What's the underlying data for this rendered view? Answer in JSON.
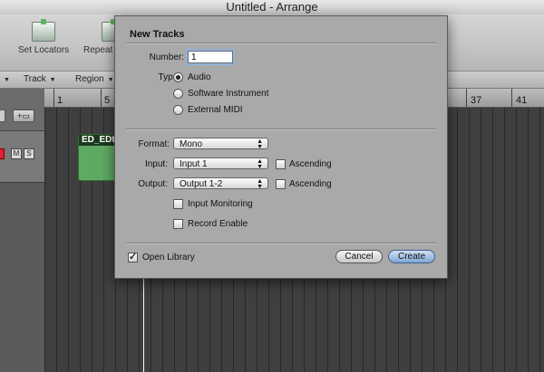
{
  "window": {
    "title": "Untitled - Arrange"
  },
  "toolbar": {
    "set_locators": "Set Locators",
    "repeat": "Repeat"
  },
  "local_menu": {
    "track": "Track",
    "region": "Region"
  },
  "ruler": {
    "bars": [
      "1",
      "5",
      "37",
      "41"
    ]
  },
  "track": {
    "mute": "M",
    "solo": "S"
  },
  "region": {
    "name": "ED_EDt"
  },
  "dialog": {
    "title": "New Tracks",
    "number_label": "Number:",
    "number_value": "1",
    "type_label": "Type:",
    "type_options": [
      "Audio",
      "Software Instrument",
      "External MIDI"
    ],
    "type_selected": "Audio",
    "format_label": "Format:",
    "format_value": "Mono",
    "input_label": "Input:",
    "input_value": "Input 1",
    "input_ascending": "Ascending",
    "output_label": "Output:",
    "output_value": "Output 1-2",
    "output_ascending": "Ascending",
    "input_monitoring": "Input Monitoring",
    "record_enable": "Record Enable",
    "open_library": "Open Library",
    "open_library_checked": true,
    "cancel": "Cancel",
    "create": "Create"
  }
}
